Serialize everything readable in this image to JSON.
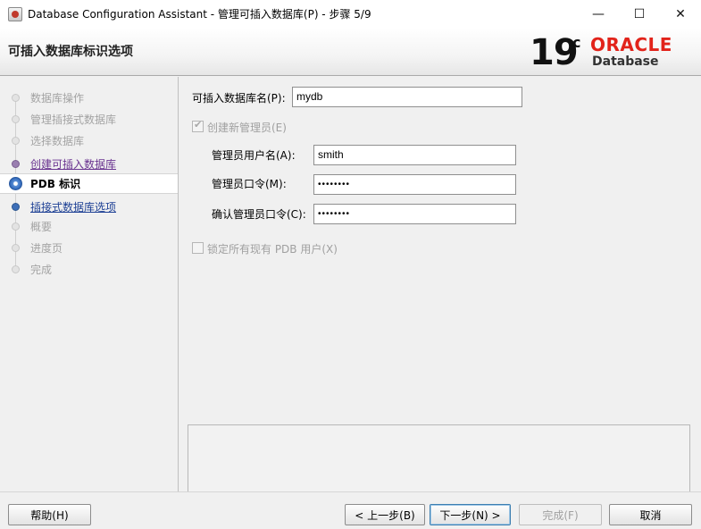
{
  "window": {
    "title": "Database Configuration Assistant - 管理可插入数据库(P) - 步骤 5/9",
    "minimize_glyph": "—",
    "maximize_glyph": "☐",
    "close_glyph": "✕"
  },
  "header": {
    "title": "可插入数据库标识选项",
    "brand_version": "19",
    "brand_version_suffix": "c",
    "brand_name": "ORACLE",
    "brand_product": "Database",
    "brand_color": "#e2231a"
  },
  "nav": {
    "items": [
      {
        "label": "数据库操作",
        "state": "done"
      },
      {
        "label": "管理插接式数据库",
        "state": "done"
      },
      {
        "label": "选择数据库",
        "state": "done"
      },
      {
        "label": "创建可插入数据库",
        "state": "visited"
      },
      {
        "label": "PDB 标识",
        "state": "current"
      },
      {
        "label": "插接式数据库选项",
        "state": "link"
      },
      {
        "label": "概要",
        "state": "pending"
      },
      {
        "label": "进度页",
        "state": "pending"
      },
      {
        "label": "完成",
        "state": "pending"
      }
    ]
  },
  "form": {
    "pdb_name_label": "可插入数据库名(P):",
    "pdb_name_value": "mydb",
    "create_admin_label": "创建新管理员(E)",
    "admin_user_label": "管理员用户名(A):",
    "admin_user_value": "smith",
    "admin_password_label": "管理员口令(M):",
    "admin_password_value": "••••••••",
    "confirm_password_label": "确认管理员口令(C):",
    "confirm_password_value": "••••••••",
    "lock_users_label": "锁定所有现有 PDB 用户(X)"
  },
  "buttons": {
    "help": "帮助(H)",
    "back": "< 上一步(B)",
    "next": "下一步(N) >",
    "finish": "完成(F)",
    "cancel": "取消"
  }
}
